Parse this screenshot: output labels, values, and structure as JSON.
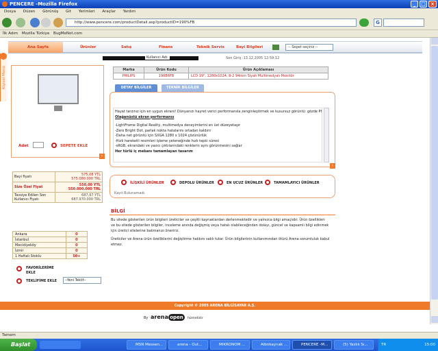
{
  "window": {
    "title": "PENCERE -Mozilla Firefox"
  },
  "menu": [
    "Dosya",
    "Düzen",
    "Görünüş",
    "Git",
    "Yerimleri",
    "Araçlar",
    "Yardım"
  ],
  "url": "http://www.pencere.com/productDetail.asp?productID=190%FB",
  "search_engine": "G",
  "bookmarks": [
    "İlk Adım",
    "Mozilla Türkiye",
    "BugMeNot.com"
  ],
  "site": {
    "side_tab": "Kişisel Menü",
    "nav": {
      "home": "Ana Sayfa",
      "items": [
        "Ürünler",
        "Satış",
        "Finans",
        "Teknik Servis",
        "Bayi Bilgileri"
      ]
    },
    "sepet_select": "-- Sepet seçiniz --",
    "user_label": "Kullanıcı Adı:",
    "last_login": "Son Giriş :13.12.2005 12:59:12",
    "product_table": {
      "headers": [
        "Marka",
        "Ürün Kodu",
        "Ürün Açıklaması"
      ],
      "row": [
        "PHILIPS",
        "190B6FB",
        "LCD 19\", 1280x1024, 8-2 94mm Siyah Multimedyalı Monitör"
      ]
    },
    "tabs": [
      "DETAY BİLGİLER",
      "TEKNİK BİLGİLER"
    ],
    "description": {
      "intro": "Hayat tarzınız için en uygun ekrani! Dünyanızı hayret verici performansla zenginleştirmek ve kusursuz görüntü: gözde Philips 19\"",
      "subtitle": "Olağanüstü ekran performansı",
      "features": [
        "-LightFrame Digital Reality, multimedya deneyimlerini en üst düzeyetaşır",
        "-Zero Bright Dot, parlak nokta hatalarını ortadan kaldırır",
        "-Daha net görüntü için SXGA 1280 x 1024 çözünürlük",
        "-Hızlı hareketli resimleri işleme yeteneğinde hızlı tepki süresi",
        "-sRGB, ekrandaki ve yazıcı çıktılarındaki renklerin aynı görünmesini sağlar",
        "Her türlü iç mekanı tamamlayan tasarım"
      ]
    },
    "quantity_label": "Adet",
    "add_to_cart": "SEPETE EKLE",
    "prices": [
      {
        "label": "Bayi fiyatı",
        "value": "575,08 YTL\n575.080.000 TRL"
      },
      {
        "label": "Size Özel Fiyat",
        "value": "550,00 YTL\n550.000.000 TRL"
      },
      {
        "label": "Tavsiye Edilen Son Kullanıcı Fiyatı",
        "value": "687,97 YTL\n687.970.000 TRL"
      }
    ],
    "stock": [
      {
        "city": "Ankara",
        "qty": "0"
      },
      {
        "city": "İstanbul",
        "qty": "0"
      },
      {
        "city": "Mecidiyeköy",
        "qty": "0"
      },
      {
        "city": "İzmir",
        "qty": "0"
      },
      {
        "city": "1 Haftalı Stoklu",
        "qty": "50+"
      }
    ],
    "favorite": "FAVORİLERİME EKLE",
    "teklif_label": "TEKLİFİME EKLE",
    "teklif_select": "--Yeni Teklif--",
    "related_tabs": [
      "İLİŞKİLİ ÜRÜNLER",
      "DEPOLU ÜRÜNLER",
      "EN UCUZ ÜRÜNLER",
      "TAMAMLAYICI ÜRÜNLER"
    ],
    "no_record": "Kayıt Bulunamadı",
    "info_title": "BİLGİ",
    "info_p1": "Bu sitede gösterilen ürün bilgileri üreticiler ve çeşitli kaynaklardan derlenmektedir ve yalnızca bilgi amaçlıdır. Ürün özellikleri ve bu sitede gösterilen bilgiler, inceleme anında değişmiş veya hatalı olabileceğinden dolayı, güncel ve kapsamlı bilgi edinmek için üretici sitelerine bakmanızı öneririz.",
    "info_p2": "Üreticiler ve Arena ürün özelliklerini değiştirme hakkını saklı tutar. Ürün bilgilerinin kullanımından ötürü Arena sorumluluk kabul etmez.",
    "copyright": "Copyright © 2005 ARENA BİLGİSAYAR A.Ş.",
    "by": "By",
    "brand": "arena",
    "brand2": "open",
    "brand_sub": "hizmetidir"
  },
  "status": "Tamam",
  "taskbar": {
    "start": "Başlat",
    "items": [
      "MSN Messen...",
      "arena - Out...",
      "MIKRONOM ...",
      "Albnkaynak ...",
      "PENCERE -M...",
      "(5) Yazlık Sı..."
    ],
    "lang": "TR",
    "clock": "15:00"
  },
  "colors": {
    "accent": "#ef7a2a",
    "red": "#cc1d1d",
    "xp_blue": "#245edb"
  }
}
